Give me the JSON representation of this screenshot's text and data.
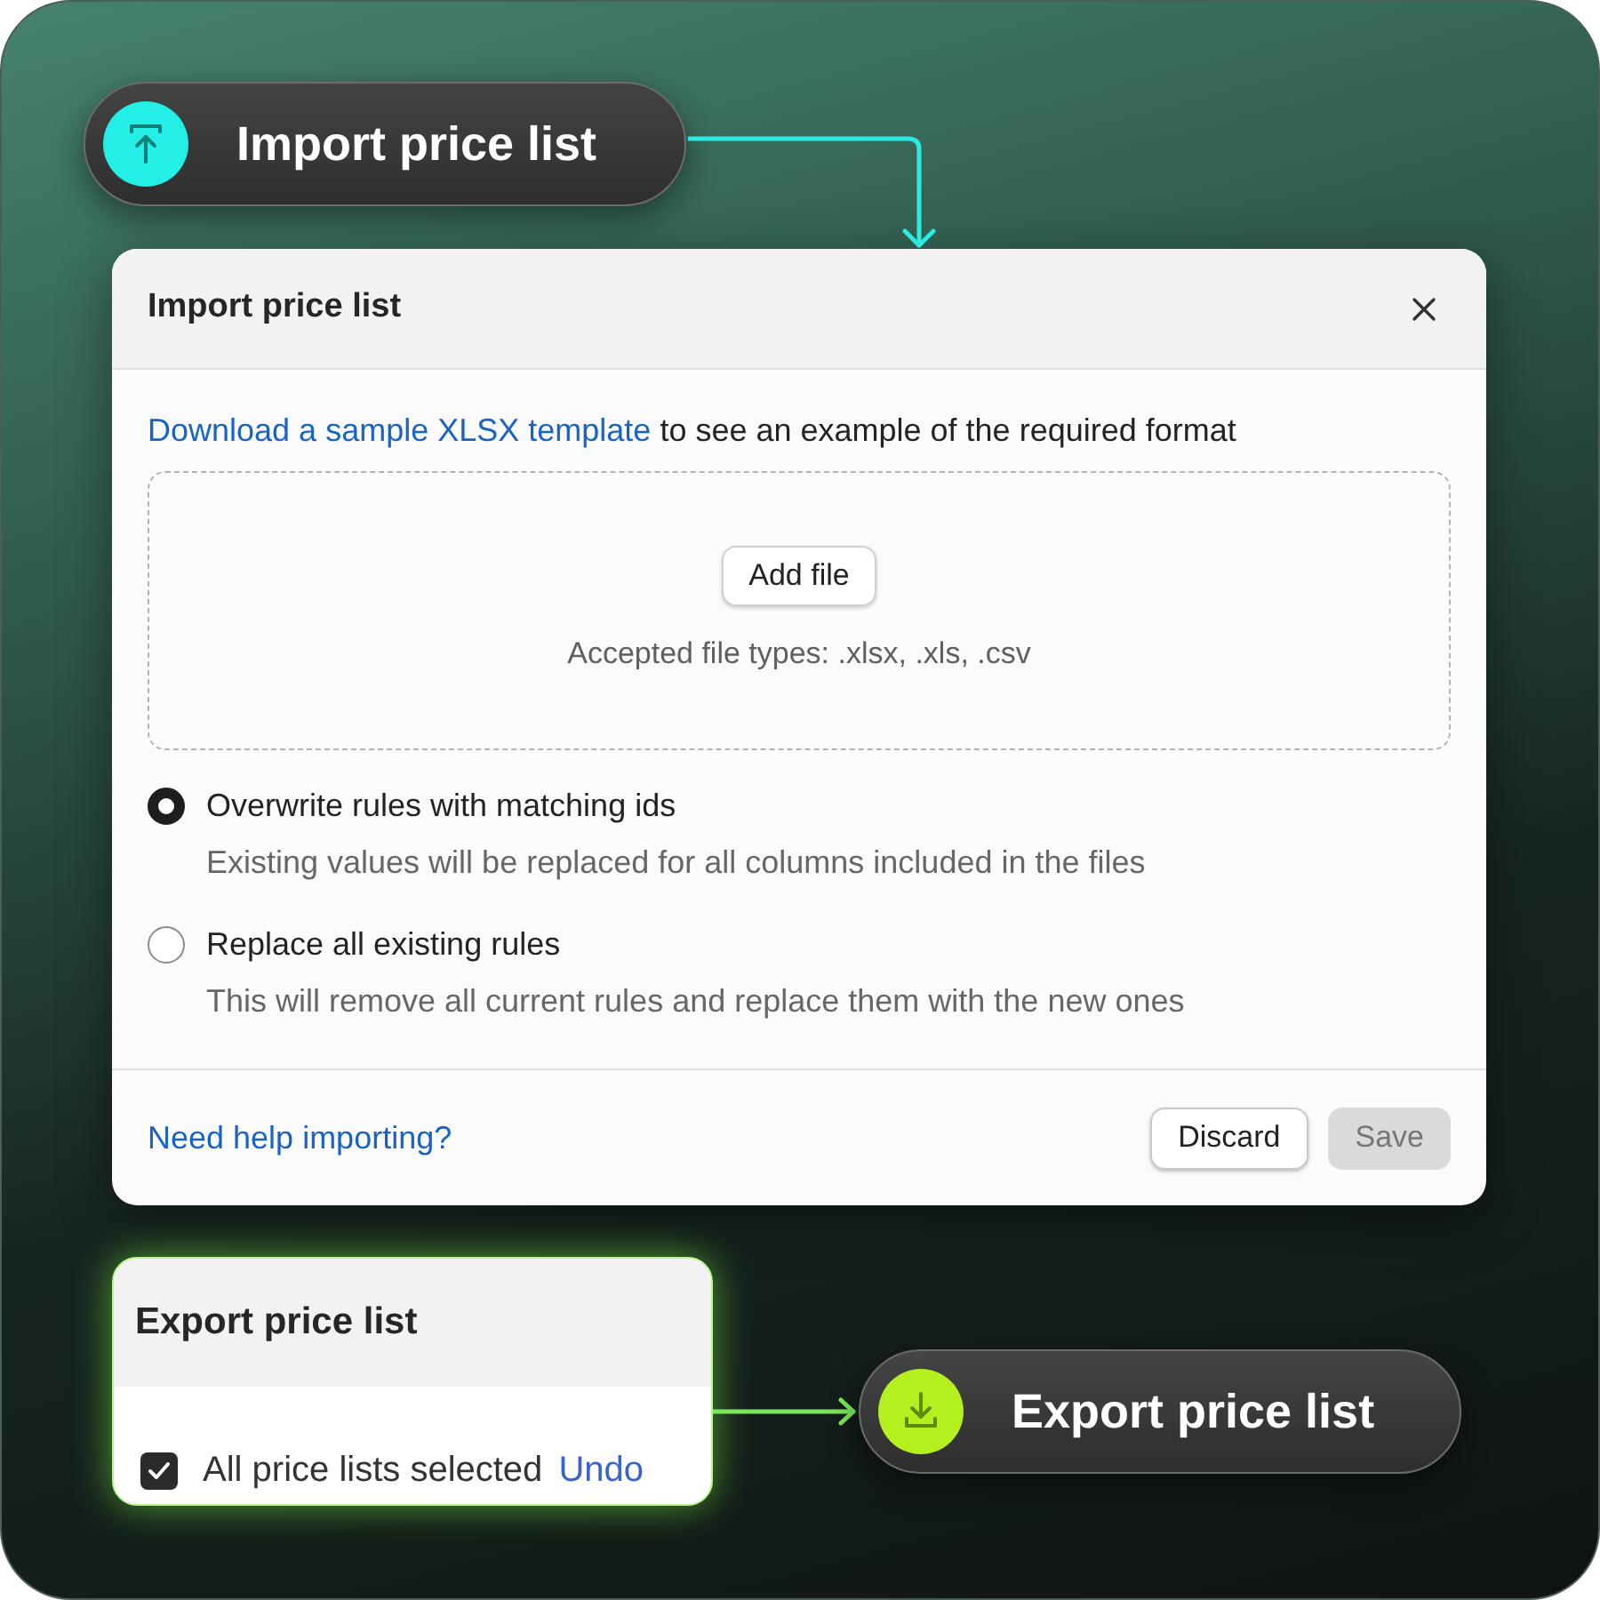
{
  "import_pill": {
    "label": "Import price list"
  },
  "import_dialog": {
    "title": "Import price list",
    "template_link": "Download a sample XLSX template",
    "template_text": "to see an example of the required format",
    "dropzone": {
      "button": "Add file",
      "hint": "Accepted file types: .xlsx, .xls, .csv"
    },
    "options": [
      {
        "label": "Overwrite rules with matching ids",
        "description": "Existing values will be replaced for all columns included in the files",
        "selected": true
      },
      {
        "label": "Replace all existing rules",
        "description": "This will remove all current rules and replace them with the new ones",
        "selected": false
      }
    ],
    "help_link": "Need help importing?",
    "buttons": [
      {
        "label": "Discard",
        "disabled": false
      },
      {
        "label": "Save",
        "disabled": true
      }
    ]
  },
  "export_card": {
    "title": "Export price list",
    "selection": {
      "checked": true,
      "label": "All price lists selected",
      "action": "Undo"
    }
  },
  "export_pill": {
    "label": "Export price list"
  }
}
